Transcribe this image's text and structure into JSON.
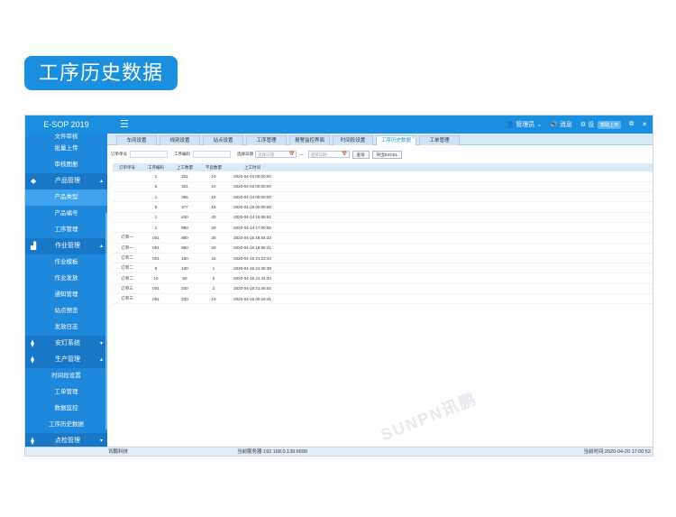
{
  "hero": {
    "title": "工序历史数据"
  },
  "topbar": {
    "brand": "E-SOP 2019",
    "menu_icon": "hamburger-icon",
    "user": "管理员",
    "messages": "消息",
    "settings": "设",
    "help_badge": "帮助上传"
  },
  "sidebar": {
    "items_top": [
      {
        "label": "文件审核"
      },
      {
        "label": "批量上传"
      },
      {
        "label": "审核图册"
      }
    ],
    "group_product": "产品管理",
    "product_items": [
      {
        "label": "产品类型",
        "active": true
      },
      {
        "label": "产品编号"
      },
      {
        "label": "工序管理"
      }
    ],
    "group_work": "作业管理",
    "work_items": [
      {
        "label": "作业模板"
      },
      {
        "label": "作业发放"
      },
      {
        "label": "通知管理"
      },
      {
        "label": "站点预览"
      },
      {
        "label": "发放日志"
      }
    ],
    "group_andon": "安灯系统",
    "group_production": "生产管理",
    "production_items": [
      {
        "label": "时间段设置"
      },
      {
        "label": "工单管理"
      },
      {
        "label": "数据监控"
      },
      {
        "label": "工序历史数据"
      }
    ],
    "group_inspect": "点检管理"
  },
  "tabs": [
    {
      "label": "车间设置"
    },
    {
      "label": "线别设置"
    },
    {
      "label": "站点设置"
    },
    {
      "label": "工序管理"
    },
    {
      "label": "报警监控界面"
    },
    {
      "label": "时间段设置"
    },
    {
      "label": "工序历史数据",
      "active": true
    },
    {
      "label": "工单管理"
    }
  ],
  "filters": {
    "order_label": "订单单号",
    "order_placeholder": "",
    "process_label": "工序编码",
    "process_placeholder": "",
    "date_label": "选择日期",
    "date_start": "选择日期",
    "date_sep": "—",
    "date_end": "选择日期",
    "query_button": "查询",
    "export_button": "导出EXCEL"
  },
  "table": {
    "columns": [
      "订单单号",
      "工序编码",
      "上工数量",
      "不良数量",
      "上工时间"
    ],
    "rows": [
      [
        "",
        "1",
        "321",
        "10",
        "2020-04-03 00:00:00"
      ],
      [
        "",
        "5",
        "321",
        "10",
        "2020-04-03 00:00:00"
      ],
      [
        "",
        "1",
        "355",
        "15",
        "2020-04-14 00:00:00"
      ],
      [
        "",
        "5",
        "377",
        "15",
        "2020-04-18 00:00:00"
      ],
      [
        "",
        "1",
        "230",
        "20",
        "2020-04-14 16:59:52"
      ],
      [
        "",
        "1",
        "880",
        "20",
        "2020-04-14 17:00:05"
      ],
      [
        "订单一",
        "001",
        "880",
        "20",
        "2020-04-15 18:54:33"
      ],
      [
        "订单一",
        "001",
        "880",
        "20",
        "2020-04-15 18:55:41"
      ],
      [
        "订单二",
        "001",
        "150",
        "15",
        "2020-04-15 21:23:34"
      ],
      [
        "订单二",
        "8",
        "100",
        "1",
        "2020-04-15 21:45:39"
      ],
      [
        "订单二",
        "10",
        "50",
        "0",
        "2020-04-15 21:41:34"
      ],
      [
        "订单三",
        "001",
        "230",
        "2",
        "2020-04-15 21:46:02"
      ],
      [
        "订单三",
        "001",
        "230",
        "10",
        "2020-04-16 00:19:41"
      ]
    ]
  },
  "statusbar": {
    "company": "讯鹏科技",
    "server": "当前服务器:192.168.0.139:6699",
    "time": "当前时间:2020-04-20 17:00:52"
  },
  "watermark": "SUNPN讯鹏",
  "colors": {
    "primary": "#1a8fe0",
    "sidebar": "#1e88dc",
    "group": "#1877c6"
  }
}
